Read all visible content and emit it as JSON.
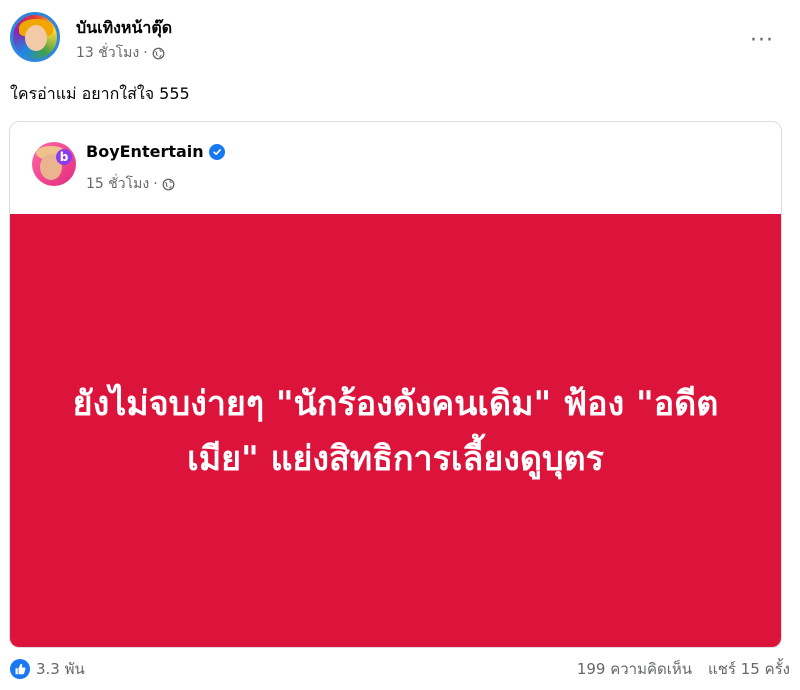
{
  "post": {
    "author": "บันเทิงหน้าตุ๊ด",
    "time": "13 ชั่วโมง",
    "separator": "·",
    "caption": "ใครอ่าแม่ อยากใส่ใจ 555",
    "more_label": "···"
  },
  "shared_post": {
    "author": "BoyEntertain",
    "time": "15 ชั่วโมง",
    "separator": "·",
    "avatar_logo": "b",
    "headline": "ยังไม่จบง่ายๆ \"นักร้องดังคนเดิม\" ฟ้อง \"อดีตเมีย\" แย่งสิทธิการเลี้ยงดูบุตร",
    "banner_color": "#dc143c"
  },
  "footer": {
    "reactions": "3.3 พัน",
    "comments": "199 ความคิดเห็น",
    "shares": "แชร์ 15 ครั้ง"
  },
  "colors": {
    "accent": "#1877f2",
    "muted_text": "#65676b"
  }
}
